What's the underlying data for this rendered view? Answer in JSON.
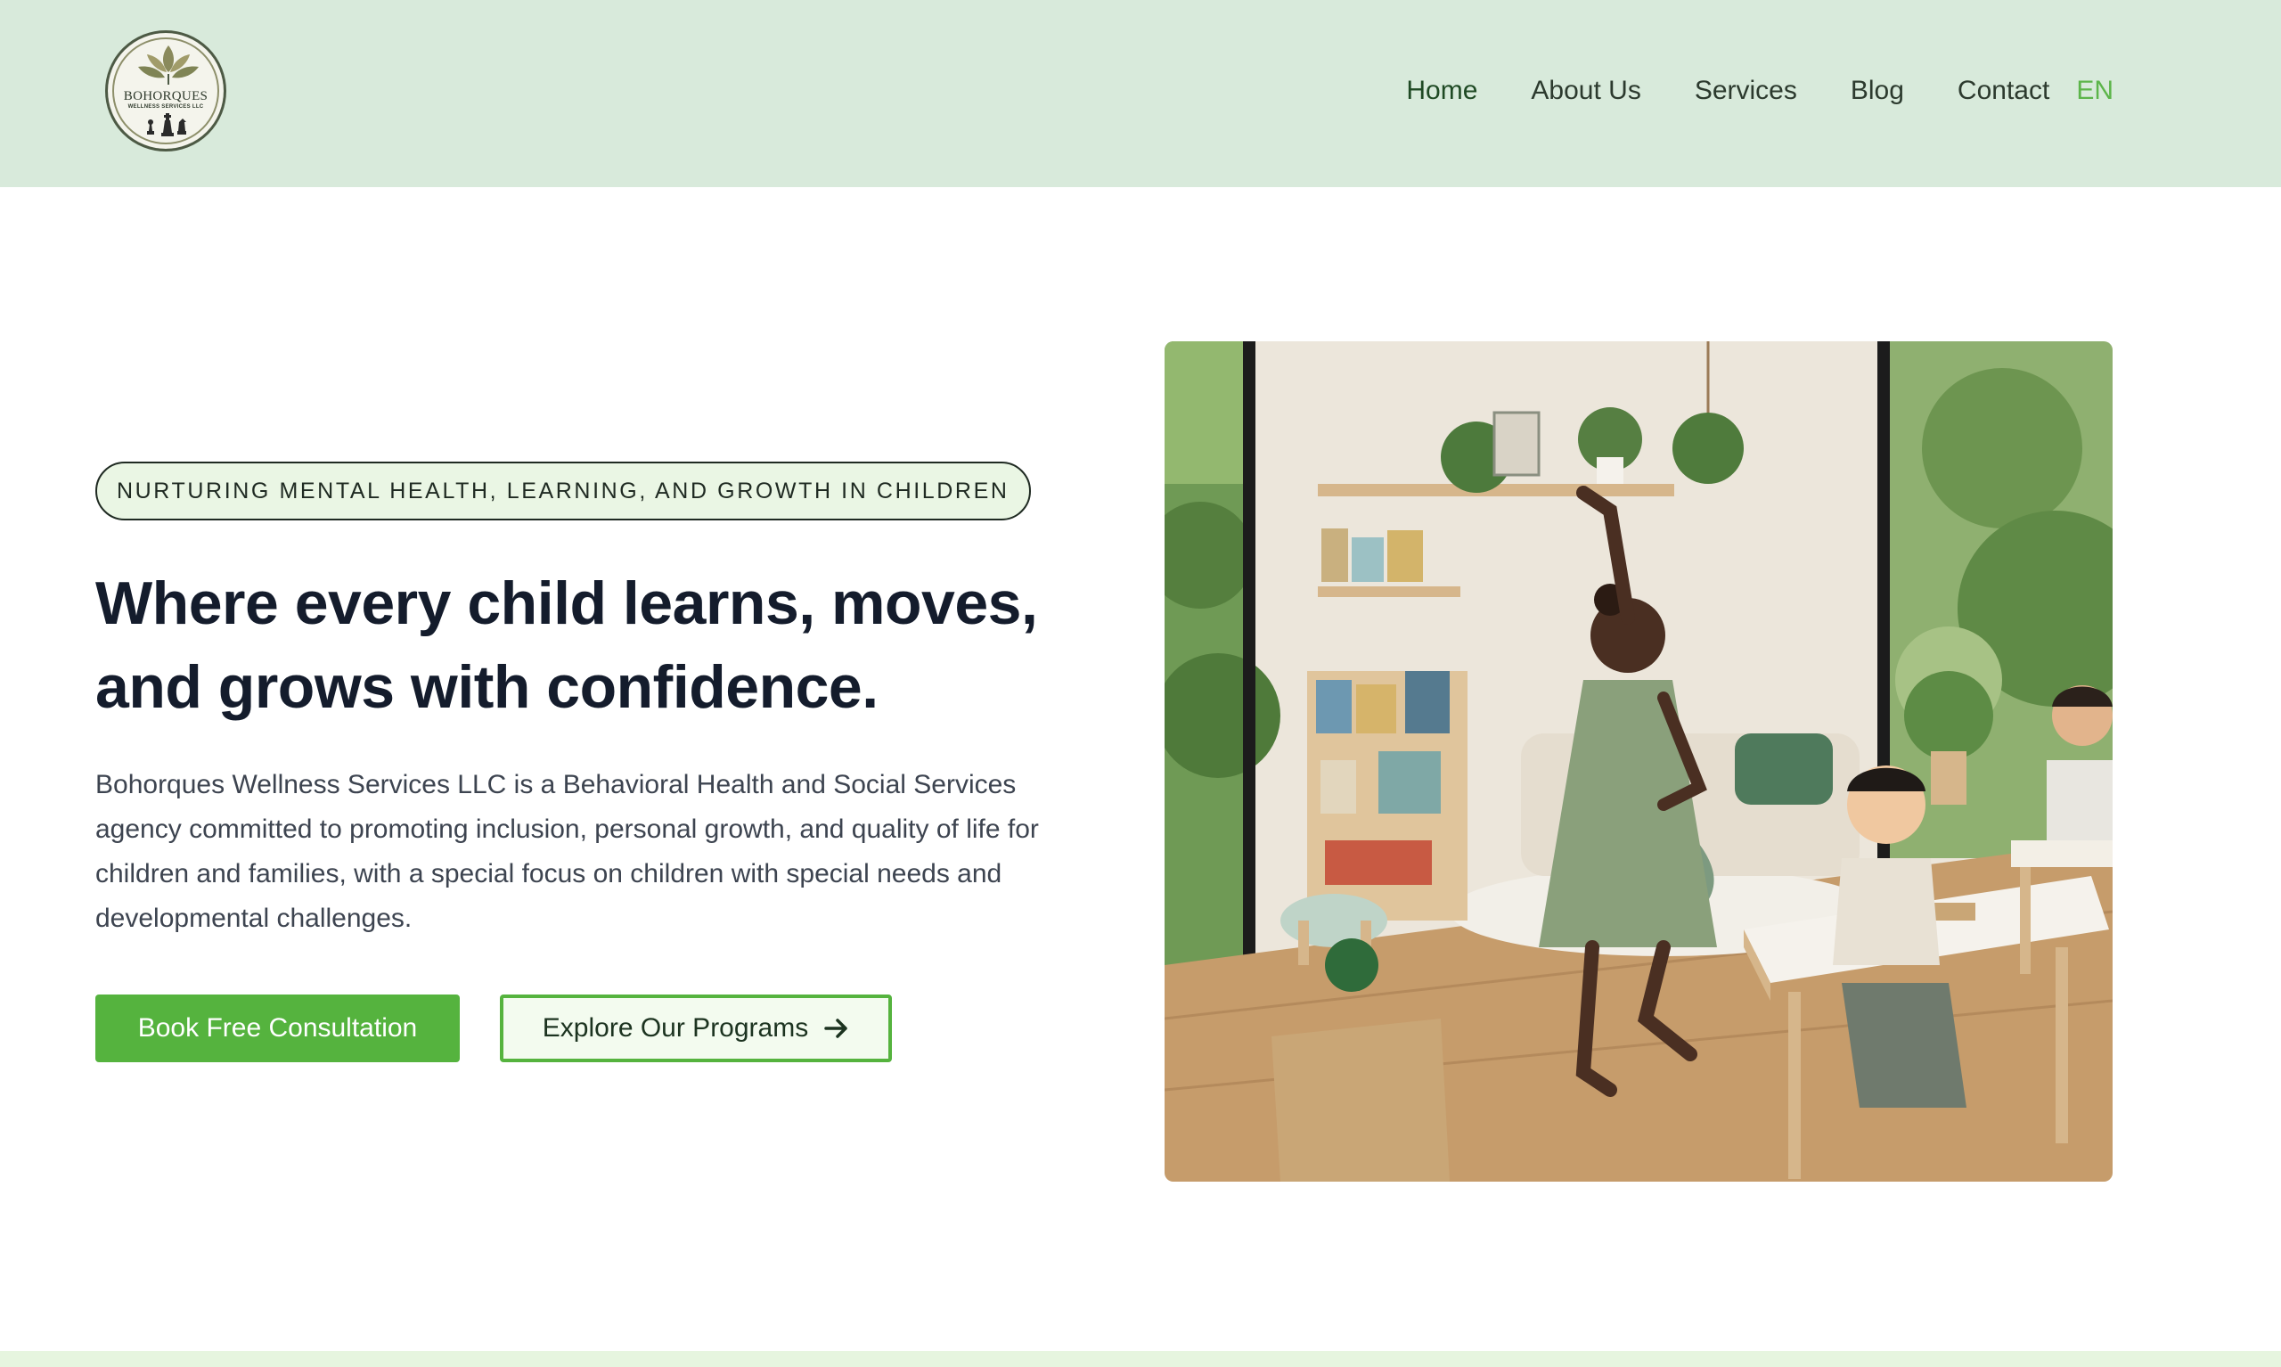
{
  "header": {
    "logo": {
      "name": "BOHORQUES",
      "subtitle": "WELLNESS SERVICES LLC"
    },
    "nav": [
      {
        "label": "Home",
        "active": true
      },
      {
        "label": "About Us",
        "active": false
      },
      {
        "label": "Services",
        "active": false
      },
      {
        "label": "Blog",
        "active": false
      },
      {
        "label": "Contact",
        "active": false
      }
    ],
    "language": "EN"
  },
  "hero": {
    "tagline": "NURTURING MENTAL HEALTH, LEARNING, AND GROWTH IN CHILDREN",
    "title_line1": "Where every child learns, moves,",
    "title_line2": "and grows with confidence.",
    "description": "Bohorques Wellness Services LLC is a Behavioral Health and Social Services agency committed to promoting inclusion, personal growth, and quality of life for children and families, with a special focus on children with special needs and developmental challenges.",
    "primary_button": "Book Free Consultation",
    "secondary_button": "Explore Our Programs",
    "secondary_button_icon": "arrow-right-icon"
  },
  "colors": {
    "header_bg": "#d8eadb",
    "accent_green": "#55b33e",
    "lang_green": "#5cb54a",
    "heading": "#141c2c",
    "tagline_bg": "#eaf6e4",
    "bottom_strip": "#e6f5df"
  }
}
